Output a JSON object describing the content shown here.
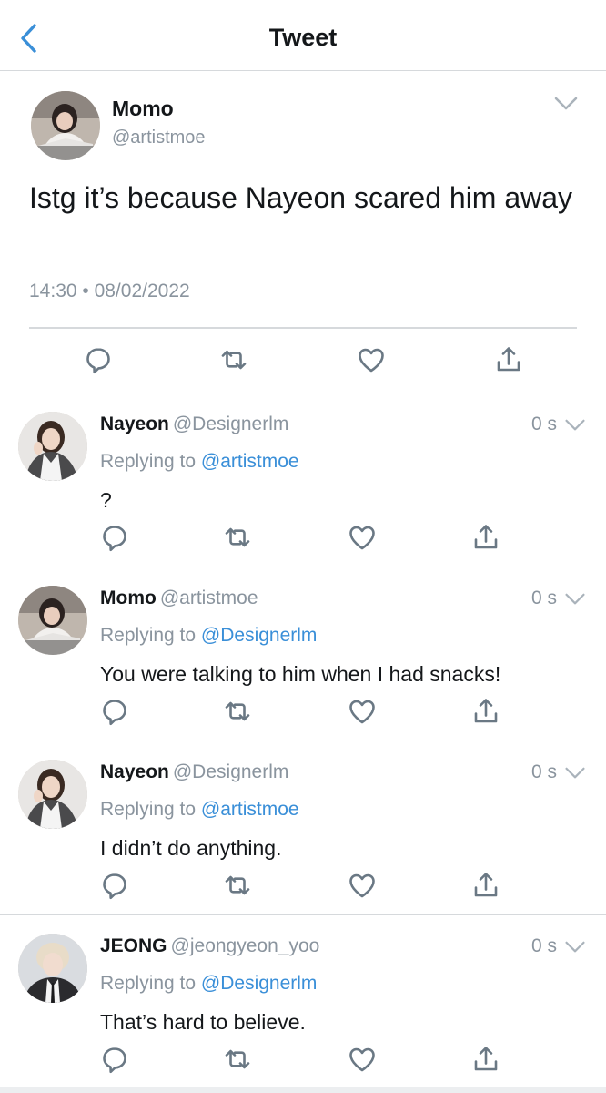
{
  "header": {
    "title": "Tweet",
    "back_icon": "chevron-left-icon"
  },
  "colors": {
    "accent": "#3a8fd8",
    "text": "#14171a",
    "muted": "#8a949e",
    "divider": "#d6d9dc"
  },
  "main_tweet": {
    "name": "Momo",
    "handle": "@artistmoe",
    "text": "Istg it’s because Nayeon scared him away",
    "timestamp": "14:30 • 08/02/2022",
    "actions": [
      "reply-icon",
      "retweet-icon",
      "like-icon",
      "share-icon"
    ]
  },
  "replies": [
    {
      "name": "Nayeon",
      "handle": "@Designerlm",
      "time": "0 s",
      "replying_prefix": "Replying to ",
      "replying_to": "@artistmoe",
      "text": "?"
    },
    {
      "name": "Momo",
      "handle": "@artistmoe",
      "time": "0 s",
      "replying_prefix": "Replying to ",
      "replying_to": "@Designerlm",
      "text": "You were talking to him when I had snacks!"
    },
    {
      "name": "Nayeon",
      "handle": "@Designerlm",
      "time": "0 s",
      "replying_prefix": "Replying to ",
      "replying_to": "@artistmoe",
      "text": "I didn’t do anything."
    },
    {
      "name": "JEONG",
      "handle": "@jeongyeon_yoo",
      "time": "0 s",
      "replying_prefix": "Replying to ",
      "replying_to": "@Designerlm",
      "text": "That’s hard to believe."
    }
  ]
}
